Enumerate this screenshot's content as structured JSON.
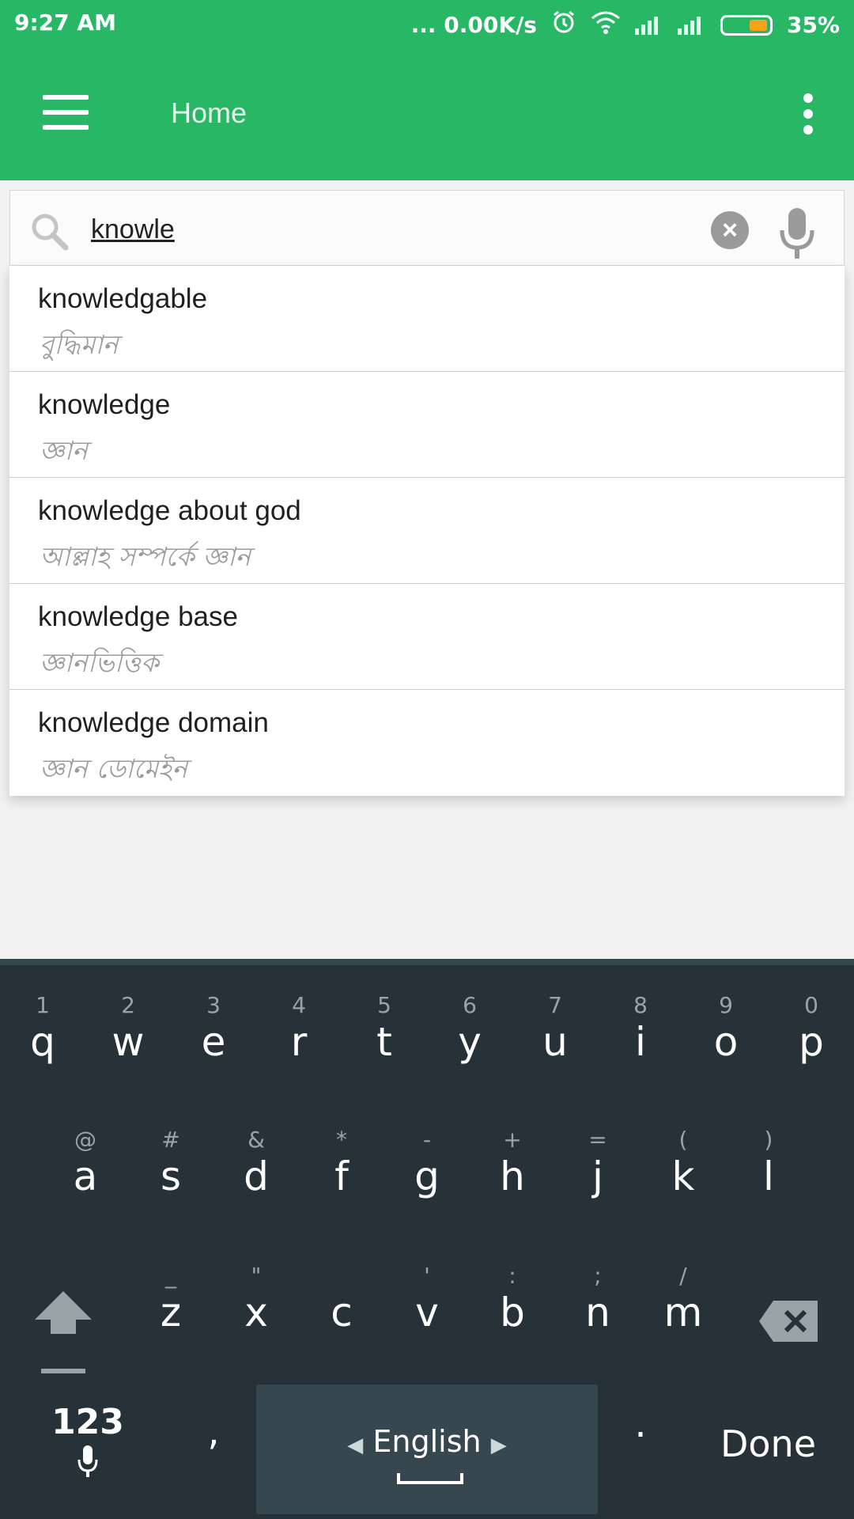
{
  "status_bar": {
    "time": "9:27 AM",
    "network_speed": "... 0.00K/s",
    "battery_percent": "35%",
    "icons": [
      "alarm-icon",
      "wifi-icon",
      "signal-icon",
      "signal-icon",
      "battery-icon"
    ]
  },
  "app_bar": {
    "title": "Home",
    "menu_icon": "hamburger-menu-icon",
    "overflow_icon": "more-vert-icon"
  },
  "search": {
    "value": "knowle",
    "placeholder": "",
    "search_icon": "search-icon",
    "clear_icon": "clear-icon",
    "mic_icon": "mic-icon"
  },
  "suggestions": [
    {
      "en": "knowledgable",
      "bn": "বুদ্ধিমান"
    },
    {
      "en": "knowledge",
      "bn": "জ্ঞান"
    },
    {
      "en": "knowledge about god",
      "bn": "আল্লাহ সম্পর্কে জ্ঞান"
    },
    {
      "en": "knowledge base",
      "bn": "জ্ঞানভিত্তিক"
    },
    {
      "en": "knowledge domain",
      "bn": "জ্ঞান ডোমেইন"
    }
  ],
  "keyboard": {
    "row1": [
      {
        "ch": "q",
        "hint": "1"
      },
      {
        "ch": "w",
        "hint": "2"
      },
      {
        "ch": "e",
        "hint": "3"
      },
      {
        "ch": "r",
        "hint": "4"
      },
      {
        "ch": "t",
        "hint": "5"
      },
      {
        "ch": "y",
        "hint": "6"
      },
      {
        "ch": "u",
        "hint": "7"
      },
      {
        "ch": "i",
        "hint": "8"
      },
      {
        "ch": "o",
        "hint": "9"
      },
      {
        "ch": "p",
        "hint": "0"
      }
    ],
    "row2": [
      {
        "ch": "a",
        "hint": "@"
      },
      {
        "ch": "s",
        "hint": "#"
      },
      {
        "ch": "d",
        "hint": "&"
      },
      {
        "ch": "f",
        "hint": "*"
      },
      {
        "ch": "g",
        "hint": "-"
      },
      {
        "ch": "h",
        "hint": "+"
      },
      {
        "ch": "j",
        "hint": "="
      },
      {
        "ch": "k",
        "hint": "("
      },
      {
        "ch": "l",
        "hint": ")"
      }
    ],
    "row3": [
      {
        "ch": "z",
        "hint": "_"
      },
      {
        "ch": "x",
        "hint": "\""
      },
      {
        "ch": "c",
        "hint": ""
      },
      {
        "ch": "v",
        "hint": "'"
      },
      {
        "ch": "b",
        "hint": ":"
      },
      {
        "ch": "n",
        "hint": ";"
      },
      {
        "ch": "m",
        "hint": "/"
      }
    ],
    "key_123": "123",
    "comma": ",",
    "period": ".",
    "space_label": "English",
    "done": "Done"
  }
}
